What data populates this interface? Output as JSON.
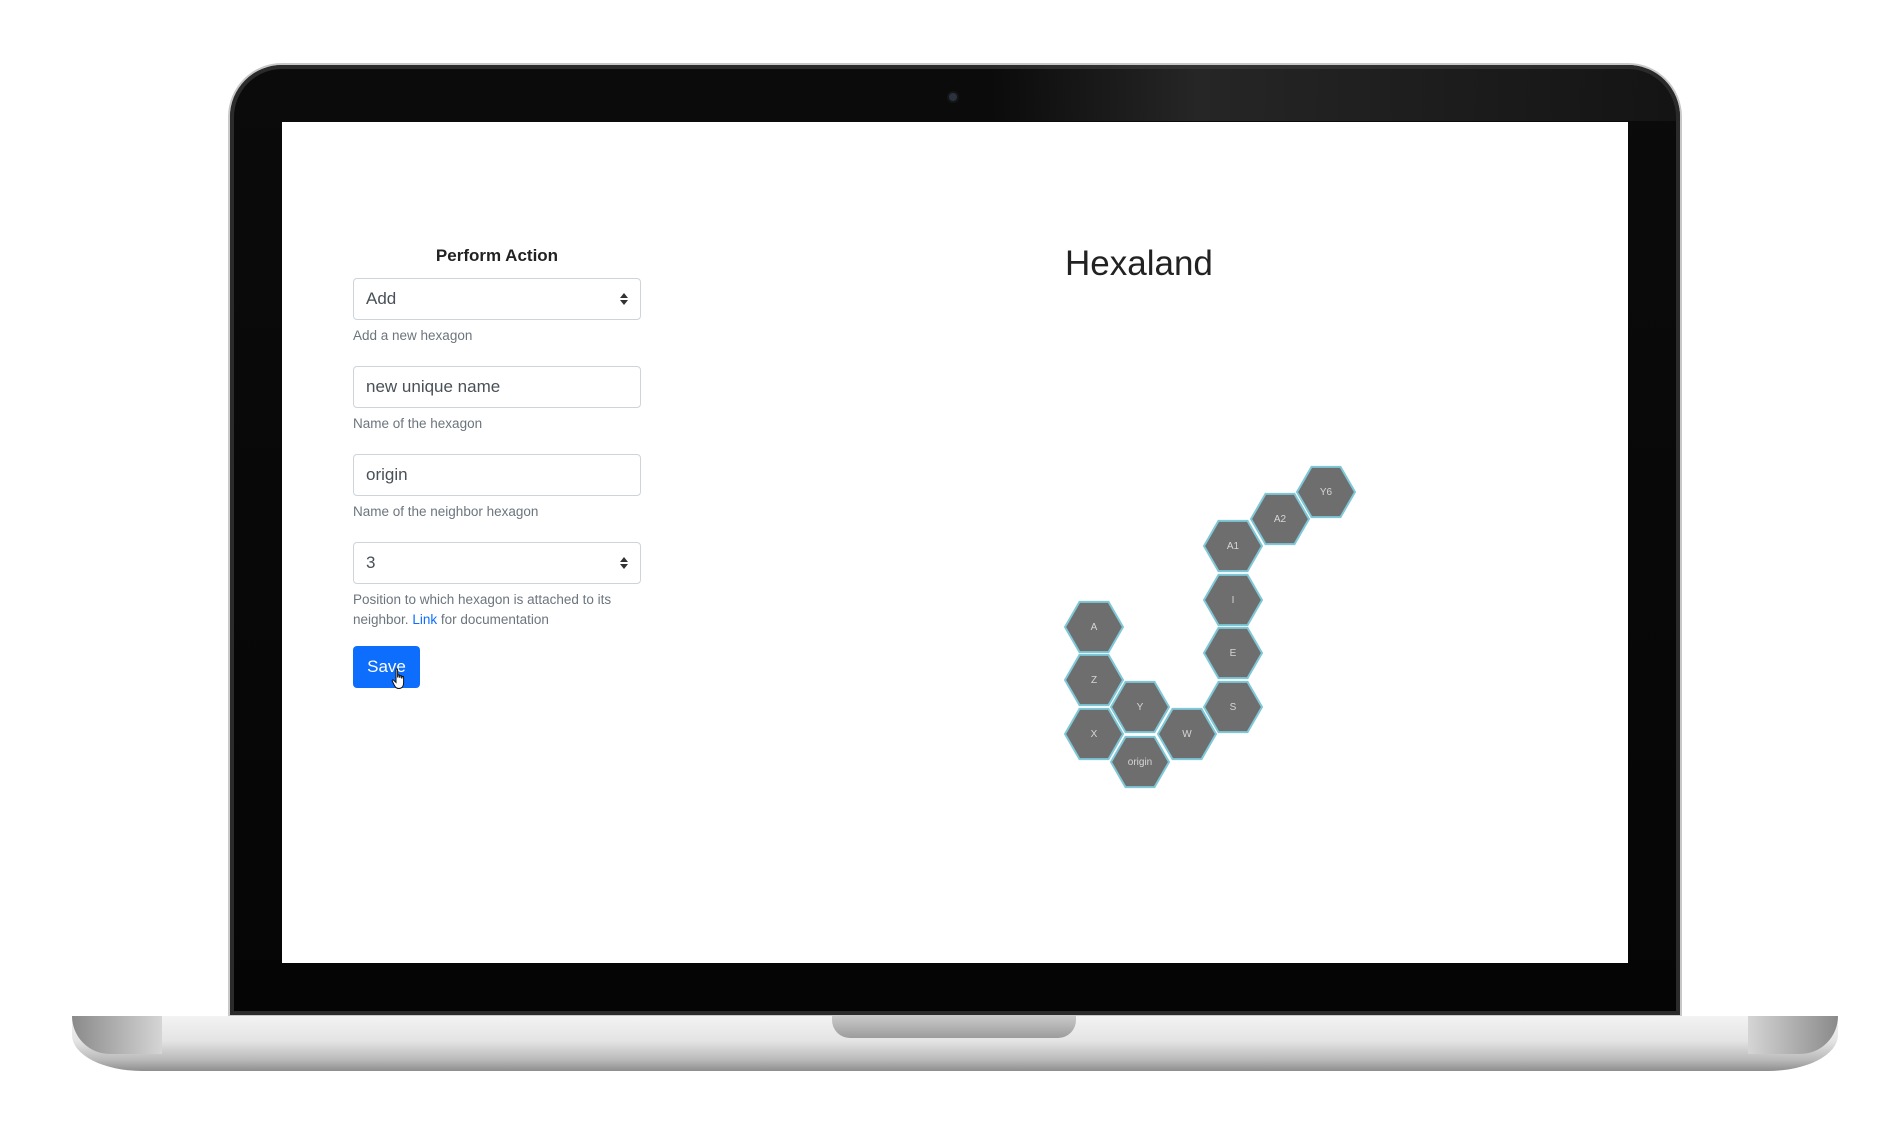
{
  "form": {
    "title": "Perform Action",
    "action_select": {
      "value": "Add",
      "help": "Add a new hexagon"
    },
    "name_input": {
      "value": "new unique name",
      "help": "Name of the hexagon"
    },
    "neighbor_input": {
      "value": "origin",
      "help": "Name of the neighbor hexagon"
    },
    "position_select": {
      "value": "3",
      "help_before": "Position to which hexagon is attached to its neighbor.",
      "help_link": "Link",
      "help_after": "for documentation"
    },
    "save_label": "Save"
  },
  "map": {
    "title": "Hexaland",
    "hexagons": [
      "A",
      "Z",
      "X",
      "Y",
      "origin",
      "W",
      "S",
      "E",
      "I",
      "A1",
      "A2",
      "Y6"
    ]
  },
  "colors": {
    "hex_fill": "#6e6e6e",
    "hex_stroke": "#7ec8d8",
    "primary": "#0d6efd"
  },
  "icons": {
    "cursor": "hand-pointer-icon",
    "select_caret": "chevron-up-down-icon"
  }
}
